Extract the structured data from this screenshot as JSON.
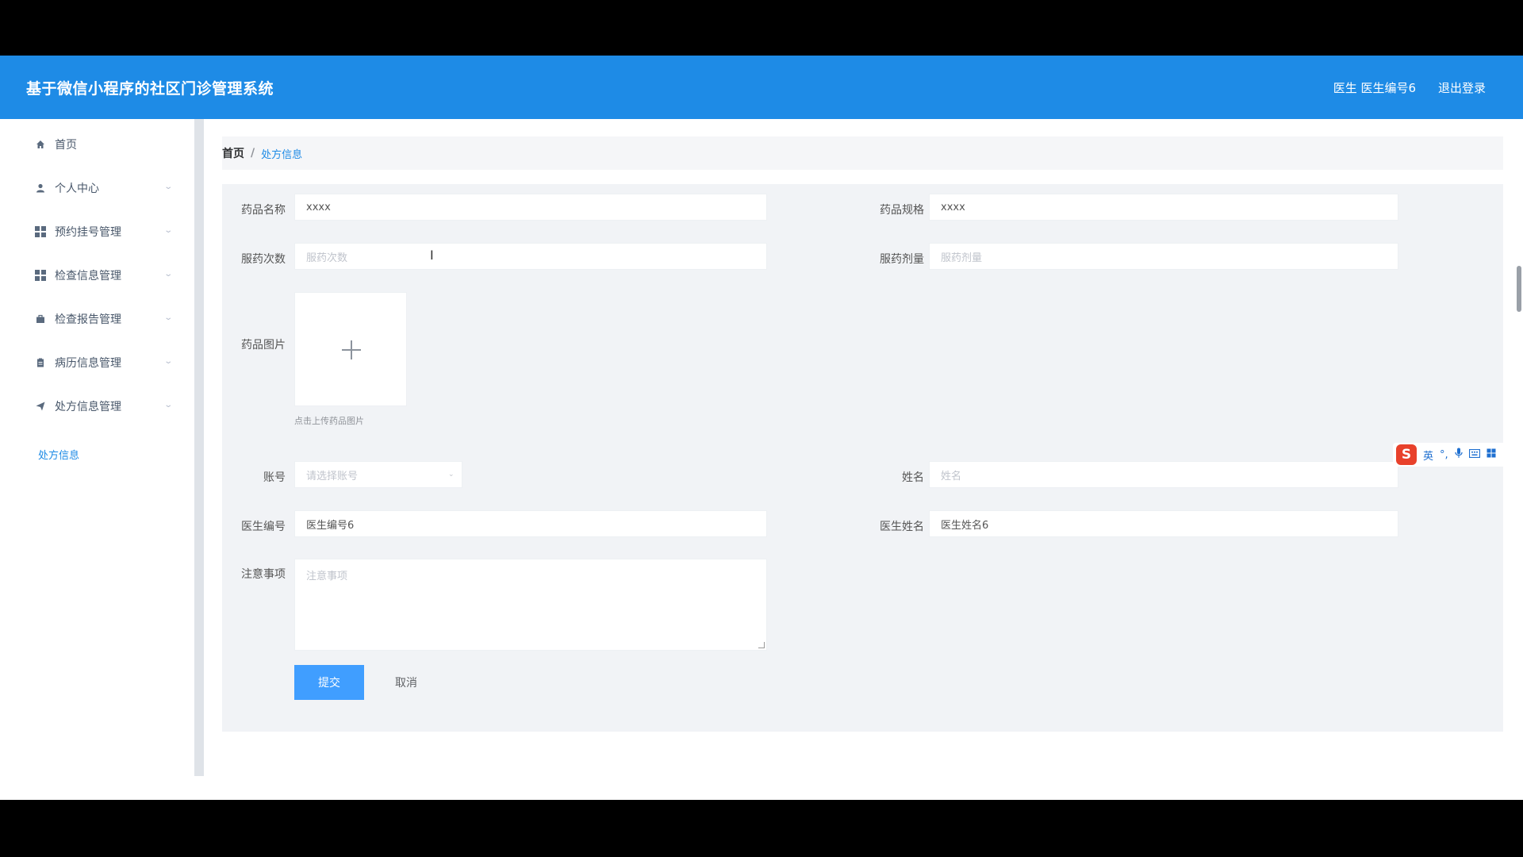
{
  "header": {
    "app_title": "基于微信小程序的社区门诊管理系统",
    "user_info": "医生 医生编号6",
    "logout": "退出登录"
  },
  "sidebar": {
    "items": [
      {
        "label": "首页",
        "icon": "home-icon"
      },
      {
        "label": "个人中心",
        "icon": "user-icon"
      },
      {
        "label": "预约挂号管理",
        "icon": "grid-icon"
      },
      {
        "label": "检查信息管理",
        "icon": "grid-icon"
      },
      {
        "label": "检查报告管理",
        "icon": "briefcase-icon"
      },
      {
        "label": "病历信息管理",
        "icon": "clipboard-icon"
      },
      {
        "label": "处方信息管理",
        "icon": "send-icon"
      }
    ],
    "sub_item": "处方信息"
  },
  "breadcrumb": {
    "home": "首页",
    "separator": "/",
    "current": "处方信息"
  },
  "form": {
    "drug_name": {
      "label": "药品名称",
      "value": "xxxx"
    },
    "drug_spec": {
      "label": "药品规格",
      "value": "xxxx"
    },
    "dose_times": {
      "label": "服药次数",
      "placeholder": "服药次数"
    },
    "dose_amount": {
      "label": "服药剂量",
      "placeholder": "服药剂量"
    },
    "drug_image": {
      "label": "药品图片",
      "tip": "点击上传药品图片"
    },
    "account": {
      "label": "账号",
      "placeholder": "请选择账号"
    },
    "name": {
      "label": "姓名",
      "placeholder": "姓名"
    },
    "doctor_id": {
      "label": "医生编号",
      "value": "医生编号6"
    },
    "doctor_name": {
      "label": "医生姓名",
      "value": "医生姓名6"
    },
    "notes": {
      "label": "注意事项",
      "placeholder": "注意事项"
    },
    "submit": "提交",
    "cancel": "取消"
  },
  "ime": {
    "logo": "S",
    "lang": "英",
    "punct": "°,"
  },
  "colors": {
    "header_bg": "#1e8be6",
    "primary_button": "#409eff",
    "active_link": "#1e8be6"
  }
}
